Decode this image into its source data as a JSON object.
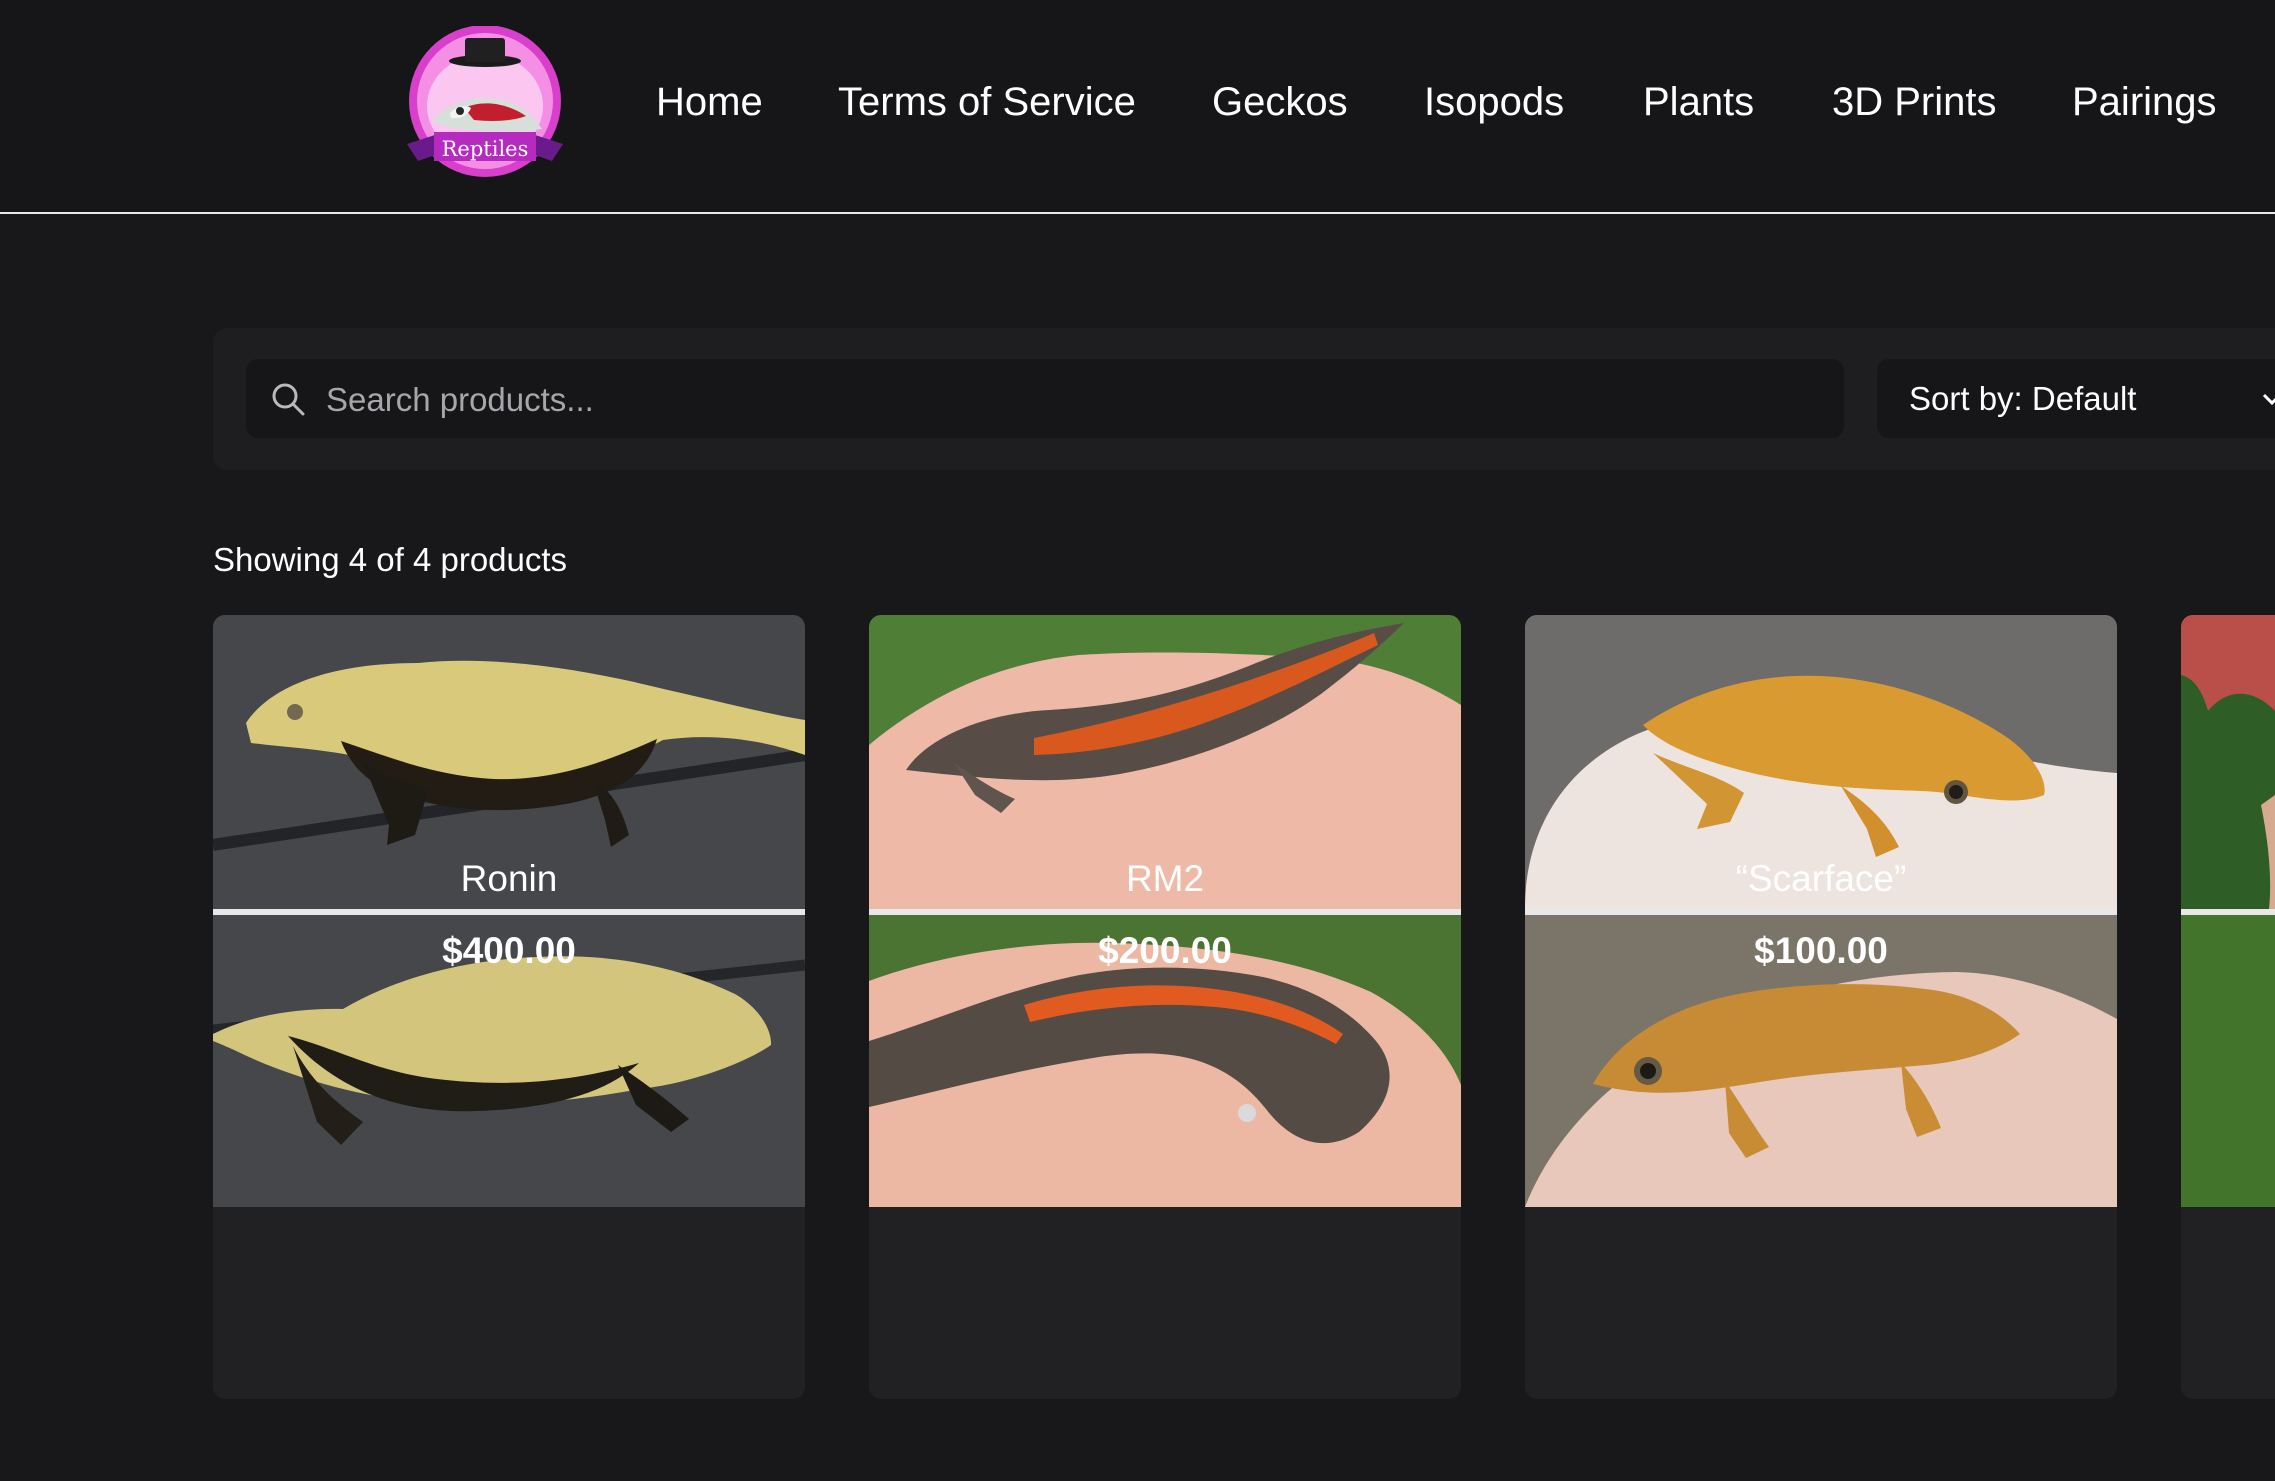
{
  "header": {
    "logo_text": "Reptiles",
    "nav": [
      {
        "label": "Home"
      },
      {
        "label": "Terms of Service"
      },
      {
        "label": "Geckos"
      },
      {
        "label": "Isopods"
      },
      {
        "label": "Plants"
      },
      {
        "label": "3D Prints"
      },
      {
        "label": "Pairings"
      }
    ]
  },
  "search": {
    "placeholder": "Search products...",
    "value": "",
    "icon": "search-icon"
  },
  "sort": {
    "label": "Sort by: Default",
    "icon": "chevron-down-icon"
  },
  "results": {
    "count_text": "Showing 4 of 4 products"
  },
  "products": [
    {
      "name": "Ronin",
      "price": "$400.00"
    },
    {
      "name": "RM2",
      "price": "$200.00"
    },
    {
      "name": "“Scarface”",
      "price": "$100.00"
    },
    {
      "name": "",
      "price": ""
    }
  ],
  "colors": {
    "background": "#18171a",
    "header": "#161518",
    "toolbar": "#1e1e20",
    "card": "#212123",
    "logo_accent": "#d83fcb"
  }
}
